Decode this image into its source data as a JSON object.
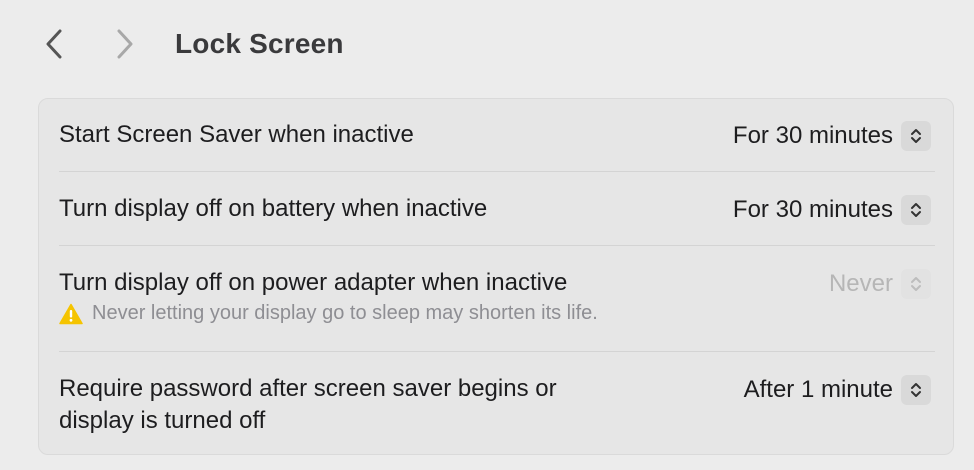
{
  "toolbar": {
    "title": "Lock Screen",
    "back_icon": "chevron-left-icon",
    "forward_icon": "chevron-right-icon"
  },
  "settings": [
    {
      "label": "Start Screen Saver when inactive",
      "value": "For 30 minutes",
      "enabled": true
    },
    {
      "label": "Turn display off on battery when inactive",
      "value": "For 30 minutes",
      "enabled": true
    },
    {
      "label": "Turn display off on power adapter when inactive",
      "value": "Never",
      "enabled": false,
      "warning": "Never letting your display go to sleep may shorten its life.",
      "warning_icon": "warning-triangle-icon"
    },
    {
      "label_line1": "Require password after screen saver begins or",
      "label_line2": "display is turned off",
      "value": "After 1 minute",
      "enabled": true
    }
  ],
  "colors": {
    "background": "#ececec",
    "card": "#e6e6e6",
    "warning": "#f5c400",
    "disabled_text": "#b6b6b6"
  }
}
